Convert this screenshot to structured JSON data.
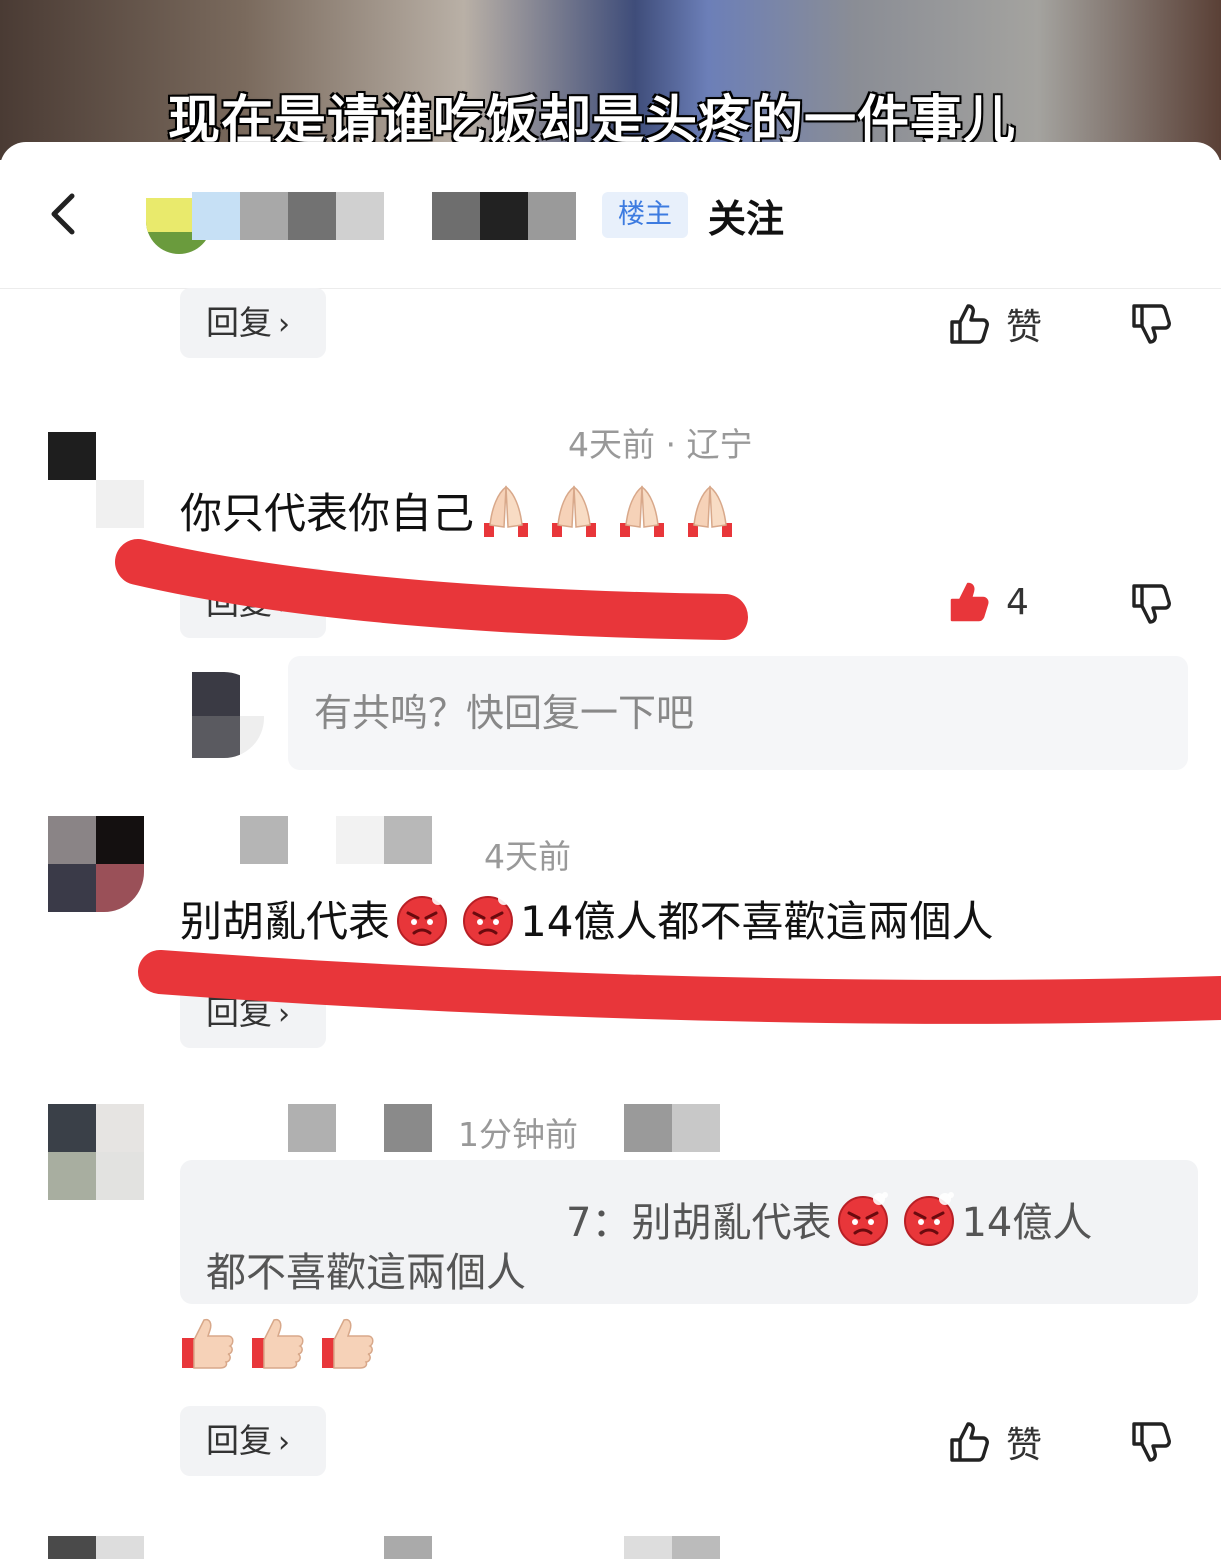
{
  "video": {
    "subtitle": "现在是请谁吃饭却是头疼的一件事儿"
  },
  "header": {
    "op_badge": "楼主",
    "follow_label": "关注"
  },
  "actions": {
    "reply_label": "回复",
    "like_label": "赞"
  },
  "comments": [
    {
      "meta": "4天前 · 辽宁",
      "text": "你只代表你自己",
      "emoji": "folded-hands-icon",
      "emoji_count": 4,
      "like_count": "4",
      "liked": true
    },
    {
      "meta": "4天前",
      "text_a": "别胡亂代表",
      "text_b": "14億人都不喜歡這兩個人",
      "emoji": "angry-face-icon",
      "emoji_count": 2
    },
    {
      "meta": "1分钟前",
      "quote_prefix": "7：",
      "quote_a": "别胡亂代表",
      "quote_b": "14億人",
      "quote_line2": "都不喜歡這兩個人",
      "emoji": "thumbs-up-icon",
      "emoji_count": 3
    }
  ],
  "reply_input": {
    "placeholder": "有共鸣？快回复一下吧"
  },
  "colors": {
    "accent_red": "#e8363a",
    "op_badge_blue": "#3d7be0",
    "liked_red": "#e8363a",
    "annotation_red": "#e8363a"
  }
}
